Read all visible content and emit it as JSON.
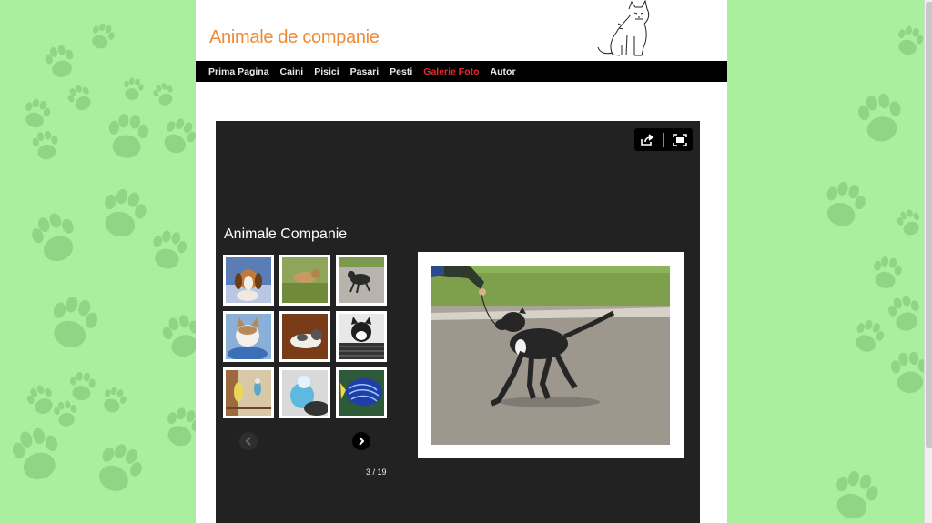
{
  "site": {
    "title": "Animale de companie",
    "accent_color": "#ee8a36",
    "background_color": "#a9ef9d"
  },
  "nav": {
    "items": [
      {
        "label": "Prima Pagina",
        "active": false
      },
      {
        "label": "Caini",
        "active": false
      },
      {
        "label": "Pisici",
        "active": false
      },
      {
        "label": "Pasari",
        "active": false
      },
      {
        "label": "Pesti",
        "active": false
      },
      {
        "label": "Galerie Foto",
        "active": true
      },
      {
        "label": "Autor",
        "active": false
      }
    ],
    "active_color": "#e52b2b"
  },
  "gallery": {
    "title": "Animale Companie",
    "counter": "3 / 19",
    "tools": {
      "share_icon": "share-icon",
      "fullscreen_icon": "fullscreen-icon"
    },
    "thumbnails": [
      {
        "subject": "beagle puppy"
      },
      {
        "subject": "dog on grass"
      },
      {
        "subject": "black dog walking"
      },
      {
        "subject": "cat on blue"
      },
      {
        "subject": "cat lying"
      },
      {
        "subject": "cat in basket"
      },
      {
        "subject": "parakeets"
      },
      {
        "subject": "blue budgie"
      },
      {
        "subject": "blue fish"
      }
    ],
    "main_image": {
      "subject": "black dog on leash"
    }
  }
}
